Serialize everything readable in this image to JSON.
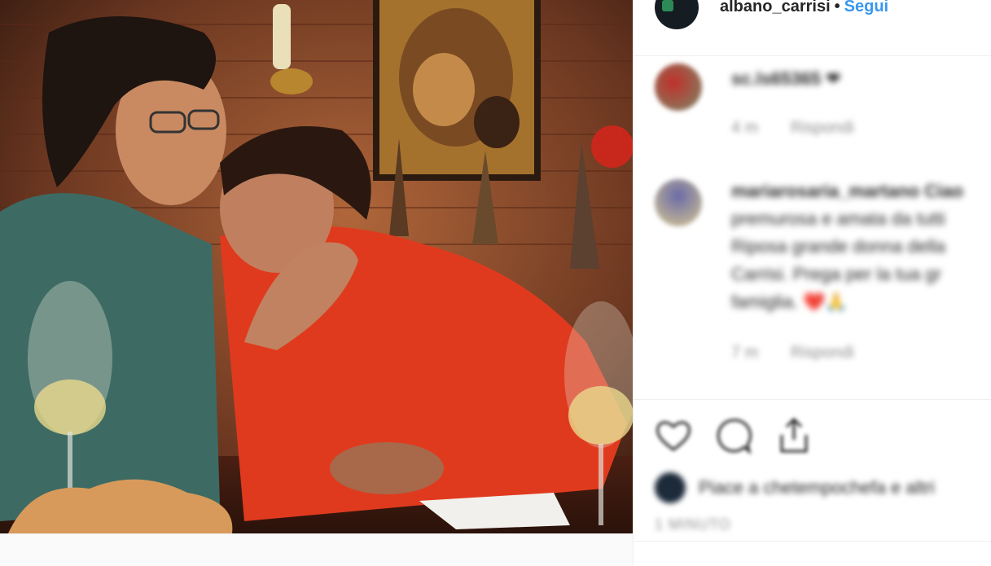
{
  "post": {
    "image_alt": "",
    "colors": {
      "follow": "#3897f0",
      "text": "#262626",
      "muted": "#8e8e8e",
      "border": "#efefef"
    }
  },
  "header": {
    "username": "albano_carrisi",
    "separator": "•",
    "follow_label": "Segui",
    "avatar_icon": "profile-avatar"
  },
  "comments": [
    {
      "username": "sc.ls65365",
      "text": "❤",
      "time": "4 m",
      "reply_label": "Rispondi"
    },
    {
      "username": "mariarosaria_martano",
      "lines": [
        "mariarosaria_martano Ciao",
        "premurosa e amata da tutti",
        "Riposa grande donna della",
        "Carrisi. Prega per la tua gr",
        "famiglia. ❤️🙏"
      ],
      "time": "7 m",
      "reply_label": "Rispondi"
    }
  ],
  "actions": {
    "like_icon": "heart-icon",
    "comment_icon": "comment-icon",
    "share_icon": "share-icon"
  },
  "likes": {
    "text": "Piace a chetempochefa e altri"
  },
  "timestamp": "1 MINUTO"
}
